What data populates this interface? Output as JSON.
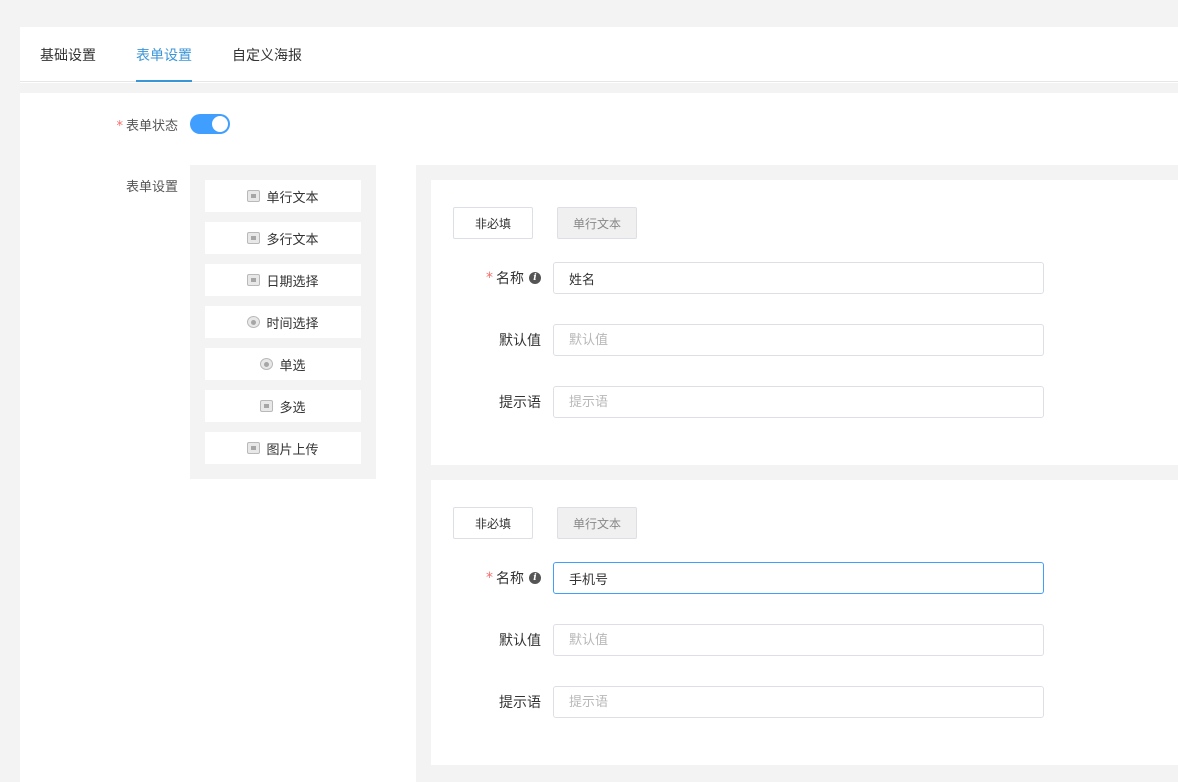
{
  "tabs": [
    {
      "label": "基础设置",
      "active": false
    },
    {
      "label": "表单设置",
      "active": true
    },
    {
      "label": "自定义海报",
      "active": false
    }
  ],
  "form_status": {
    "label": "表单状态",
    "required_mark": "*",
    "enabled": true
  },
  "form_settings_label": "表单设置",
  "palette": [
    {
      "label": "单行文本",
      "icon": "text-icon"
    },
    {
      "label": "多行文本",
      "icon": "multiline-text-icon"
    },
    {
      "label": "日期选择",
      "icon": "calendar-icon"
    },
    {
      "label": "时间选择",
      "icon": "clock-icon"
    },
    {
      "label": "单选",
      "icon": "radio-icon"
    },
    {
      "label": "多选",
      "icon": "checkbox-icon"
    },
    {
      "label": "图片上传",
      "icon": "image-icon"
    }
  ],
  "cards": [
    {
      "required_toggle": "非必填",
      "type_label": "单行文本",
      "name_label": "名称",
      "name_value": "姓名",
      "default_label": "默认值",
      "default_placeholder": "默认值",
      "hint_label": "提示语",
      "hint_placeholder": "提示语"
    },
    {
      "required_toggle": "非必填",
      "type_label": "单行文本",
      "name_label": "名称",
      "name_value": "手机号",
      "default_label": "默认值",
      "default_placeholder": "默认值",
      "hint_label": "提示语",
      "hint_placeholder": "提示语"
    }
  ],
  "colors": {
    "accent": "#409eff",
    "tab_active": "#3b96d8",
    "required": "#f56c6c"
  }
}
